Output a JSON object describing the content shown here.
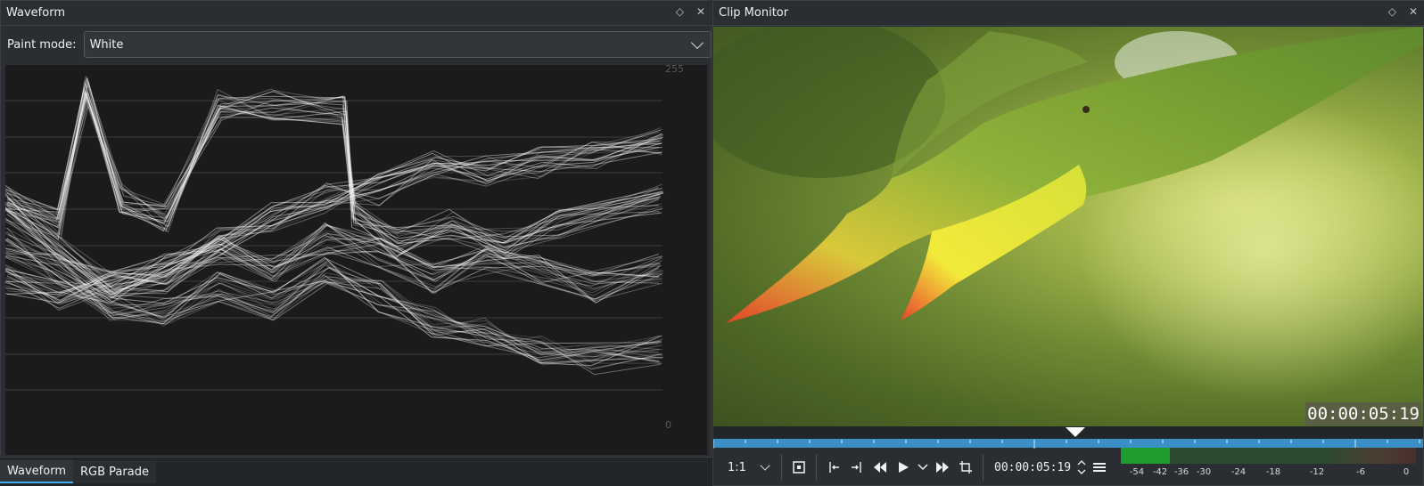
{
  "left_panel": {
    "title": "Waveform",
    "paint_mode_label": "Paint mode:",
    "paint_mode_value": "White",
    "scale_top": "255",
    "scale_bottom": "0",
    "tabs": [
      {
        "label": "Waveform",
        "active": true
      },
      {
        "label": "RGB Parade",
        "active": false
      }
    ]
  },
  "right_panel": {
    "title": "Clip Monitor",
    "timecode_overlay": "00:00:05:19",
    "zoom_value": "1:1",
    "timecode": "00:00:05:19",
    "playhead_position": 0.51,
    "vu_level_db": -42,
    "vu_labels": [
      "-54",
      "-42",
      "-36",
      "-30",
      "-24",
      "-18",
      "-12",
      "-6",
      "0"
    ]
  },
  "colors": {
    "accent": "#3daee9",
    "ruler": "#3a8fc7",
    "vu_green": "#1f9c2e"
  }
}
